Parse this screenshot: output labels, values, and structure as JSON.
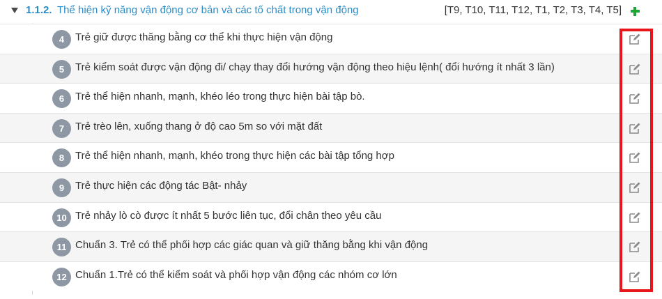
{
  "section": {
    "code": "1.1.2.",
    "title": "Thể hiện kỹ năng vận động cơ bản và các tố chất trong vận động",
    "months": "[T9, T10, T11, T12, T1, T2, T3, T4, T5]",
    "add_icon": "plus-icon"
  },
  "criteria": [
    {
      "number": "4",
      "text": "Trẻ giữ được thăng bằng cơ thể khi thực hiện vận động"
    },
    {
      "number": "5",
      "text": "Trẻ kiểm soát được vận động đi/ chạy thay đổi hướng vận động theo hiệu lệnh( đổi hướng ít nhất 3 lần)"
    },
    {
      "number": "6",
      "text": "Trẻ thể hiện nhanh, mạnh, khéo léo trong thực hiện bài tập bò."
    },
    {
      "number": "7",
      "text": "Trẻ trèo lên, xuống thang ở độ cao 5m so với mặt đất"
    },
    {
      "number": "8",
      "text": "Trẻ thể hiện nhanh, mạnh, khéo trong thực hiện các bài tập tổng hợp"
    },
    {
      "number": "9",
      "text": "Trẻ thực hiện các động tác Bật- nhảy"
    },
    {
      "number": "10",
      "text": "Trẻ nhảy lò cò được ít nhất 5 bước liên tục, đổi chân theo yêu cầu"
    },
    {
      "number": "11",
      "text": "Chuẩn 3. Trẻ có thể phối hợp các giác quan và giữ thăng bằng khi vận động"
    },
    {
      "number": "12",
      "text": "Chuẩn 1.Trẻ có thể kiểm soát và phối hợp vận động các nhóm cơ lớn"
    }
  ],
  "colors": {
    "accent": "#2a8bc6",
    "badge": "#8e98a4",
    "add": "#22a335",
    "highlight": "#e8161b"
  },
  "edit_icon": "edit-icon"
}
